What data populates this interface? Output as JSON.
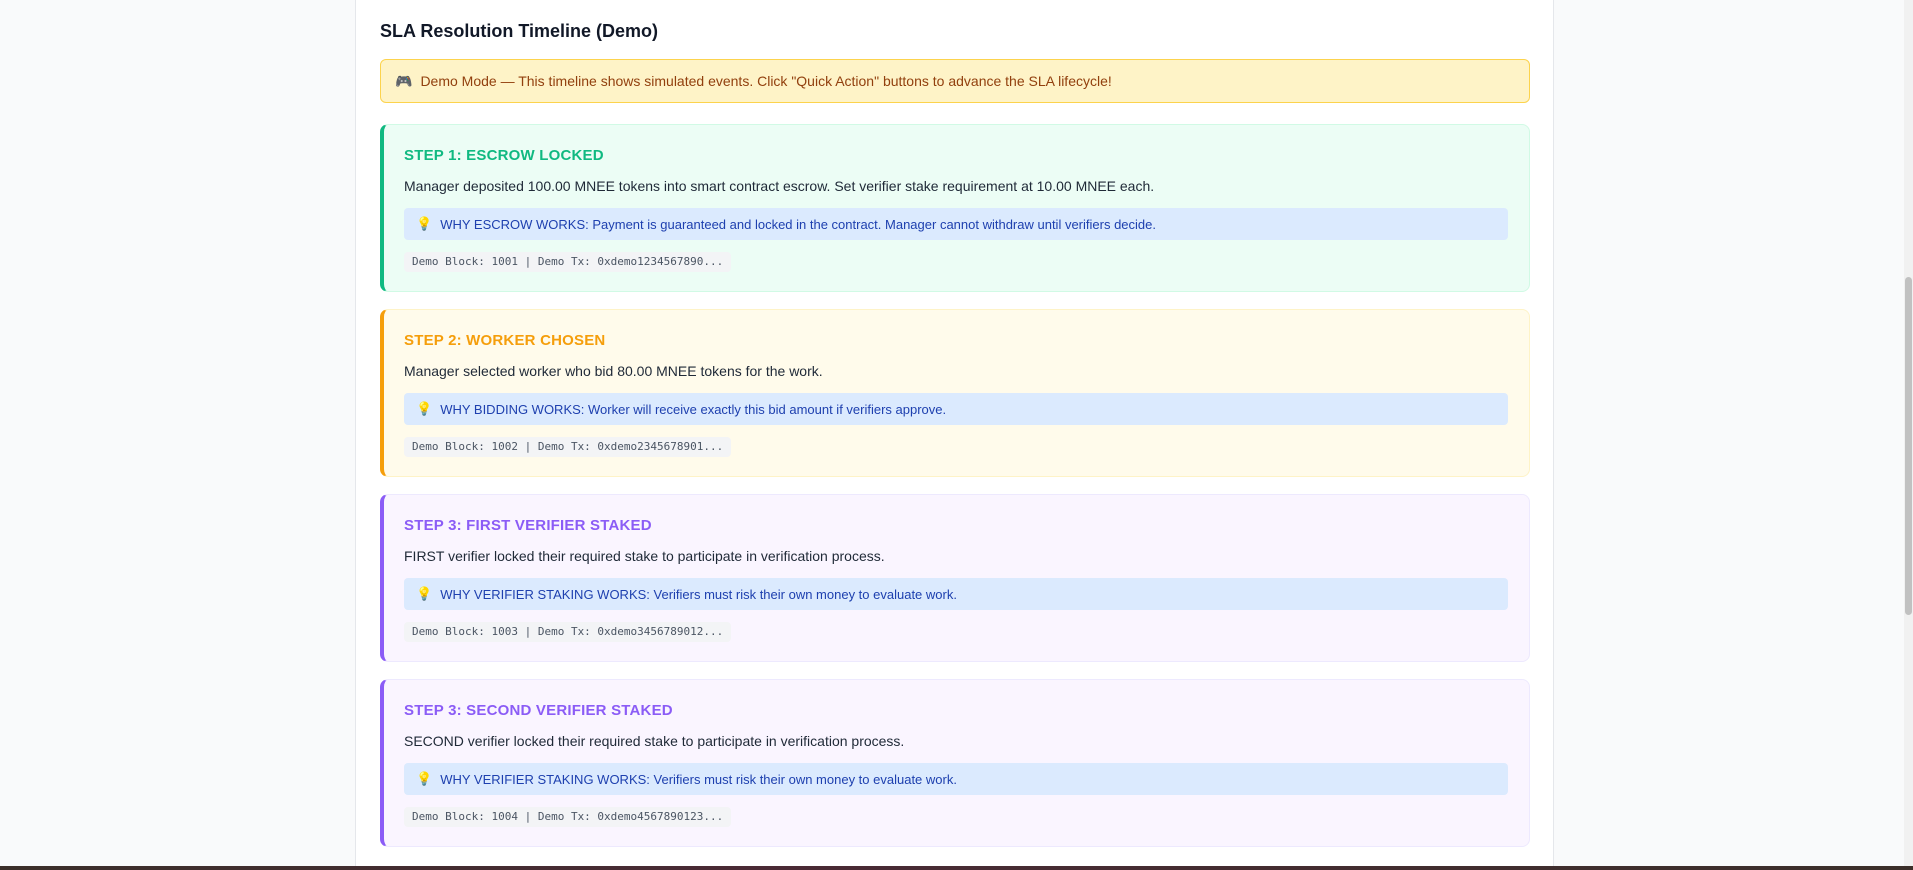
{
  "panel": {
    "title": "SLA Resolution Timeline (Demo)"
  },
  "banner": {
    "icon": "🎮",
    "icon_name": "gamepad-icon",
    "text": "Demo Mode — This timeline shows simulated events. Click \"Quick Action\" buttons to advance the SLA lifecycle!"
  },
  "steps": [
    {
      "title": "STEP 1: ESCROW LOCKED",
      "description": "Manager deposited 100.00 MNEE tokens into smart contract escrow. Set verifier stake requirement at 10.00 MNEE each.",
      "why_icon": "💡",
      "why": "WHY ESCROW WORKS: Payment is guaranteed and locked in the contract. Manager cannot withdraw until verifiers decide.",
      "tx": "Demo Block: 1001 | Demo Tx: 0xdemo1234567890...",
      "accent": "#10b981"
    },
    {
      "title": "STEP 2: WORKER CHOSEN",
      "description": "Manager selected worker who bid 80.00 MNEE tokens for the work.",
      "why_icon": "💡",
      "why": "WHY BIDDING WORKS: Worker will receive exactly this bid amount if verifiers approve.",
      "tx": "Demo Block: 1002 | Demo Tx: 0xdemo2345678901...",
      "accent": "#f59e0b"
    },
    {
      "title": "STEP 3: FIRST VERIFIER STAKED",
      "description": "FIRST verifier locked their required stake to participate in verification process.",
      "why_icon": "💡",
      "why": "WHY VERIFIER STAKING WORKS: Verifiers must risk their own money to evaluate work.",
      "tx": "Demo Block: 1003 | Demo Tx: 0xdemo3456789012...",
      "accent": "#8b5cf6"
    },
    {
      "title": "STEP 3: SECOND VERIFIER STAKED",
      "description": "SECOND verifier locked their required stake to participate in verification process.",
      "why_icon": "💡",
      "why": "WHY VERIFIER STAKING WORKS: Verifiers must risk their own money to evaluate work.",
      "tx": "Demo Block: 1004 | Demo Tx: 0xdemo4567890123...",
      "accent": "#8b5cf6"
    }
  ]
}
